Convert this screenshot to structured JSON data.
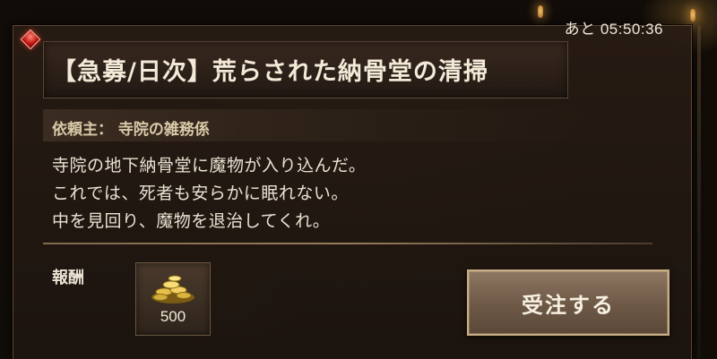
{
  "timer": {
    "text": "あと 05:50:36"
  },
  "quest": {
    "title": "【急募/日次】荒らされた納骨堂の清掃",
    "client": "依頼主： 寺院の雑務係",
    "description": [
      "寺院の地下納骨堂に魔物が入り込んだ。",
      "これでは、死者も安らかに眠れない。",
      "中を見回り、魔物を退治してくれ。"
    ]
  },
  "reward": {
    "label": "報酬",
    "icon": "gold-coins-icon",
    "count": "500"
  },
  "accept_button": {
    "label": "受注する"
  },
  "colors": {
    "accent_gem": "#c0140f",
    "button_border": "#c9ad82",
    "text": "#eae2d2"
  }
}
